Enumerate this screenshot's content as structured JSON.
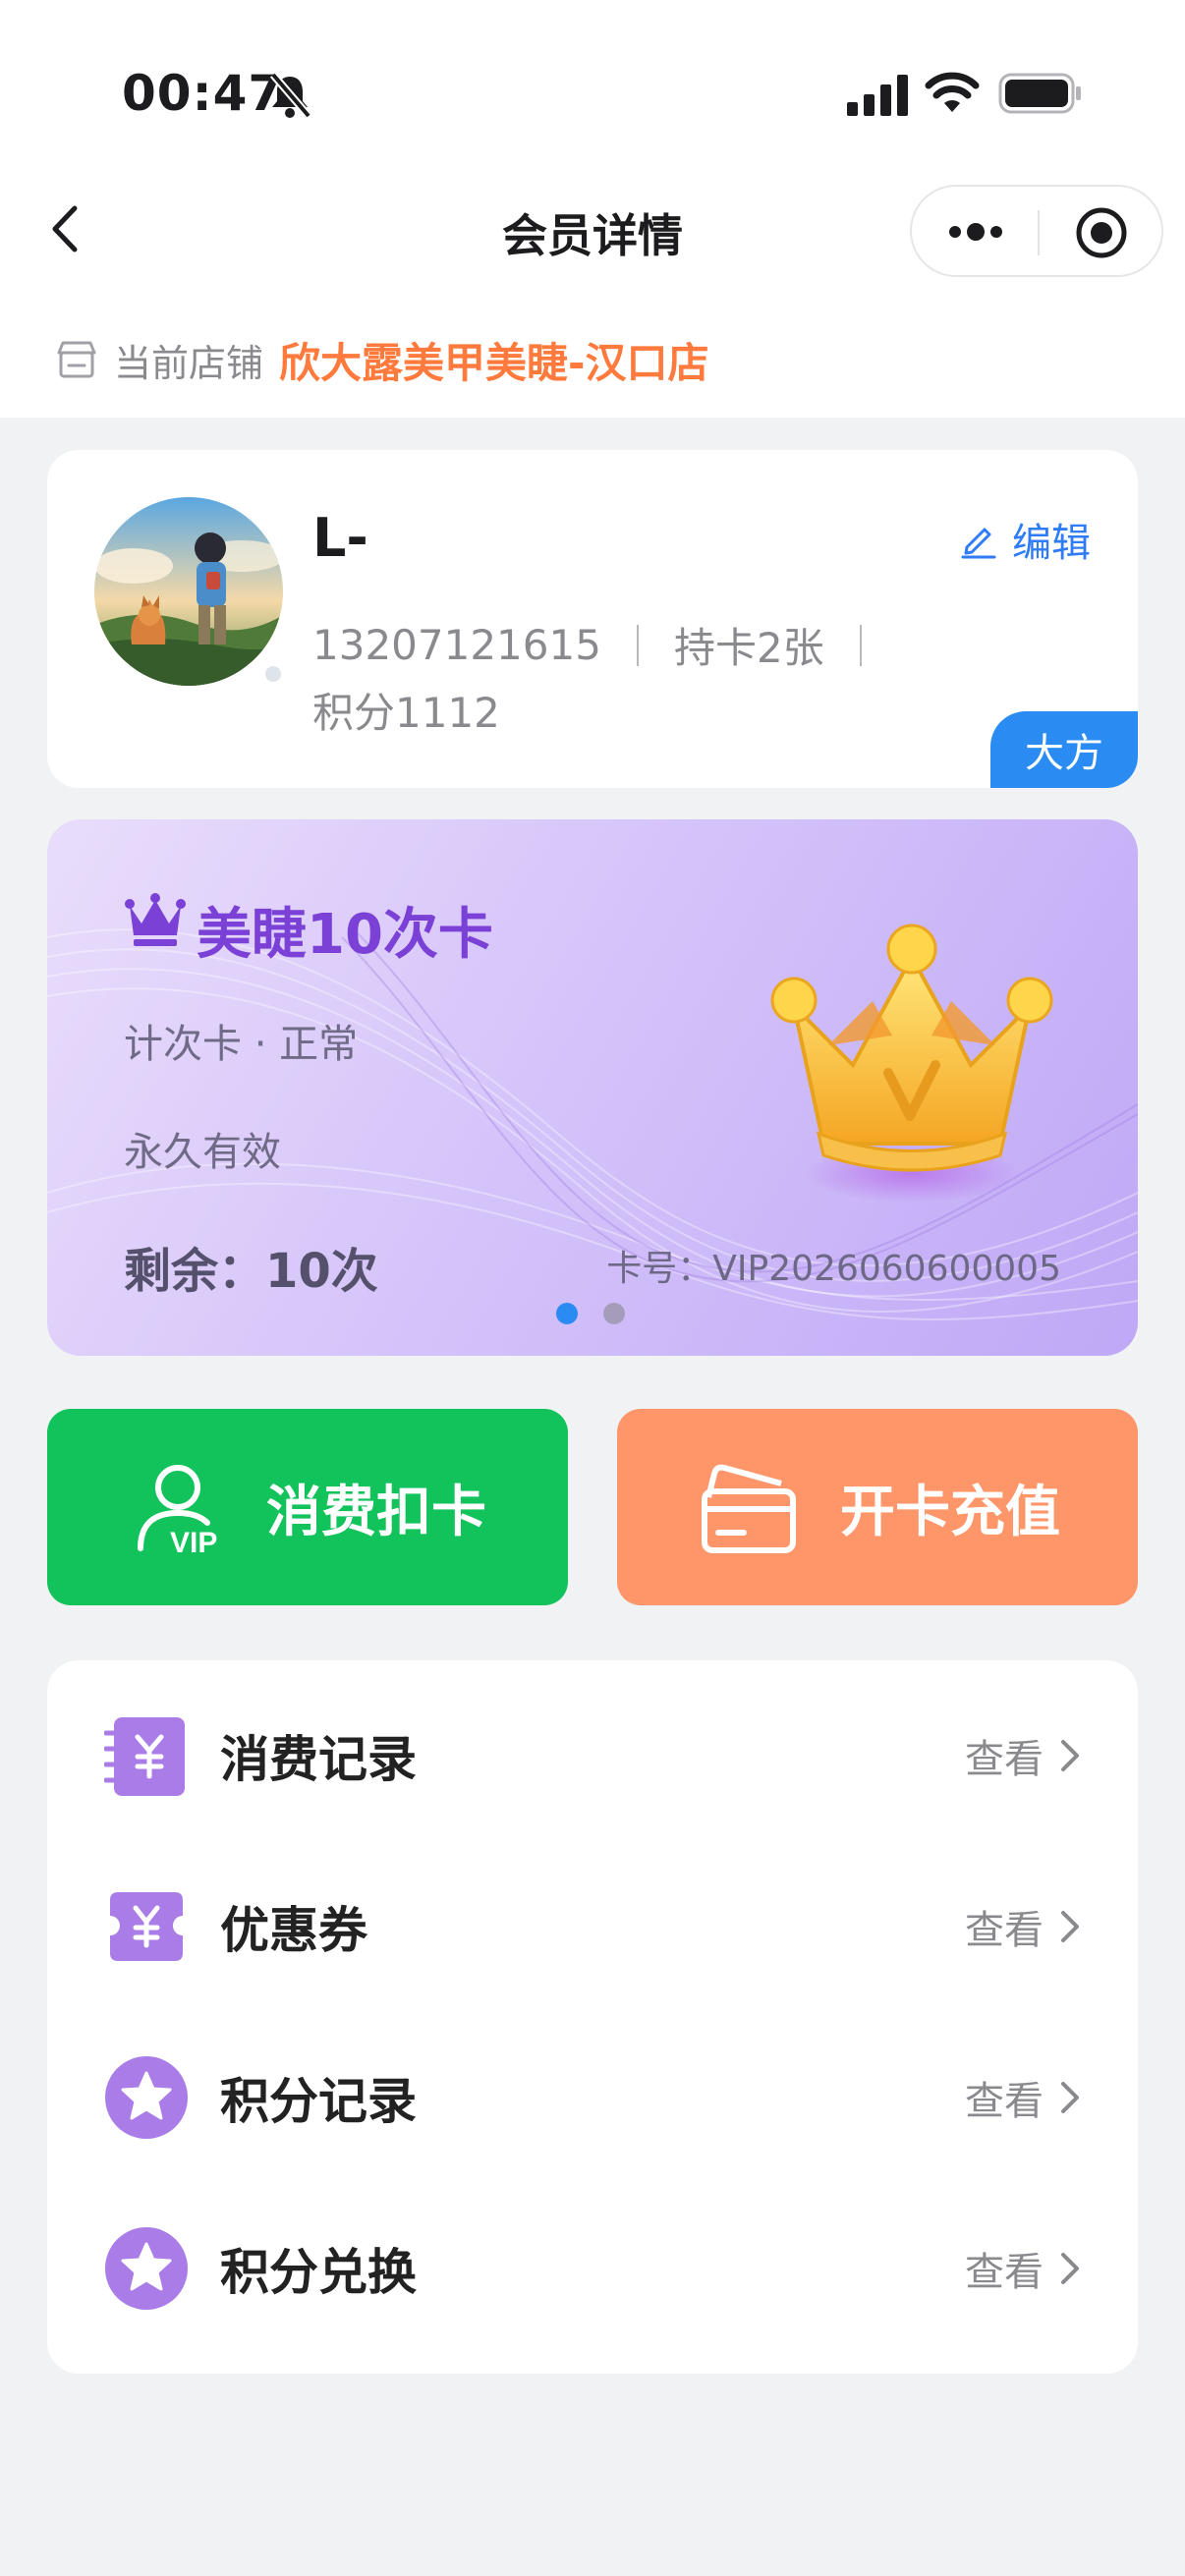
{
  "status_bar": {
    "time": "00:47"
  },
  "nav": {
    "title": "会员详情"
  },
  "store": {
    "label": "当前店铺",
    "name": "欣大露美甲美睫-汉口店"
  },
  "profile": {
    "name": "L-",
    "edit_label": "编辑",
    "phone": "13207121615",
    "cards": "持卡2张",
    "points": "积分1112",
    "tag": "大方"
  },
  "vip_card": {
    "title": "美睫10次卡",
    "type_status": "计次卡 · 正常",
    "validity": "永久有效",
    "remaining": "剩余：10次",
    "card_no": "卡号：VIP2026060600005",
    "pages": 2,
    "active_page": 1
  },
  "actions": {
    "consume_label": "消费扣卡",
    "recharge_label": "开卡充值",
    "vip_text": "VIP"
  },
  "list": {
    "items": [
      {
        "label": "消费记录",
        "action": "查看",
        "icon": "receipt-yen-icon"
      },
      {
        "label": "优惠券",
        "action": "查看",
        "icon": "coupon-icon"
      },
      {
        "label": "积分记录",
        "action": "查看",
        "icon": "star-icon"
      },
      {
        "label": "积分兑换",
        "action": "查看",
        "icon": "star-icon"
      }
    ]
  },
  "colors": {
    "accent_blue": "#2a8cf2",
    "store_orange": "#ff7a3c",
    "consume_green": "#12c25a",
    "recharge_orange": "#ff966a",
    "list_icon_purple": "#a97ce8",
    "vip_title_purple": "#7b41d6"
  }
}
